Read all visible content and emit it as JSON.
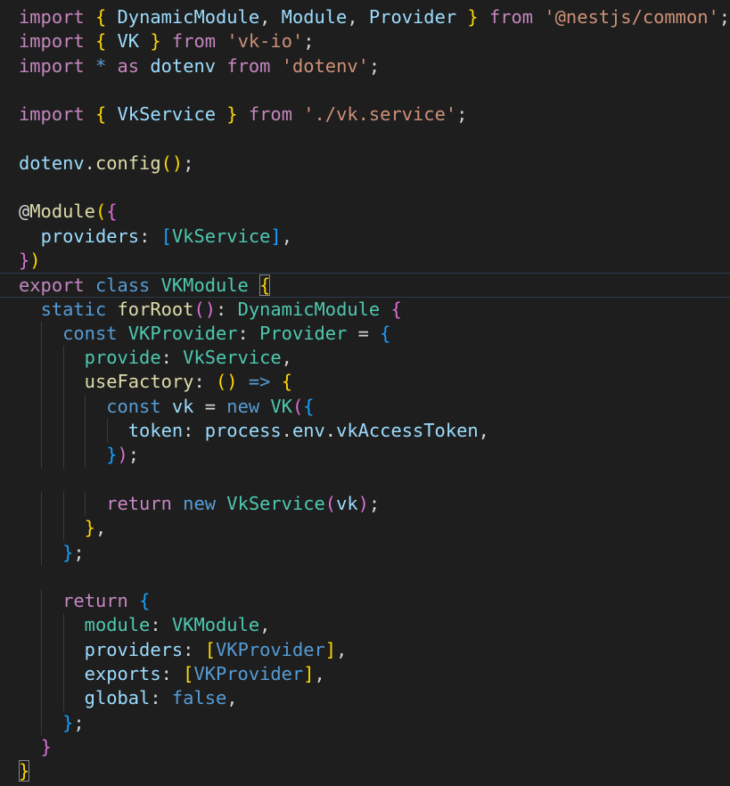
{
  "colors": {
    "background": "#1e1e1e",
    "keyword": "#c586c0",
    "storage": "#569cd6",
    "type": "#4ec9b0",
    "function": "#dcdcaa",
    "variable": "#9cdcfe",
    "string": "#ce9178",
    "plain": "#d4d4d4",
    "bracket_gold": "#ffd700",
    "bracket_pink": "#da70d6",
    "bracket_blue": "#179fff"
  },
  "lines": [
    [
      {
        "t": "import",
        "c": "keyword"
      },
      {
        "t": " "
      },
      {
        "t": "{",
        "c": "bracket_gold"
      },
      {
        "t": " "
      },
      {
        "t": "DynamicModule",
        "c": "variable"
      },
      {
        "t": ", "
      },
      {
        "t": "Module",
        "c": "variable"
      },
      {
        "t": ", "
      },
      {
        "t": "Provider",
        "c": "variable"
      },
      {
        "t": " "
      },
      {
        "t": "}",
        "c": "bracket_gold"
      },
      {
        "t": " "
      },
      {
        "t": "from",
        "c": "keyword"
      },
      {
        "t": " "
      },
      {
        "t": "'@nestjs/common'",
        "c": "string"
      },
      {
        "t": ";"
      }
    ],
    [
      {
        "t": "import",
        "c": "keyword"
      },
      {
        "t": " "
      },
      {
        "t": "{",
        "c": "bracket_gold"
      },
      {
        "t": " "
      },
      {
        "t": "VK",
        "c": "variable"
      },
      {
        "t": " "
      },
      {
        "t": "}",
        "c": "bracket_gold"
      },
      {
        "t": " "
      },
      {
        "t": "from",
        "c": "keyword"
      },
      {
        "t": " "
      },
      {
        "t": "'vk-io'",
        "c": "string"
      },
      {
        "t": ";"
      }
    ],
    [
      {
        "t": "import",
        "c": "keyword"
      },
      {
        "t": " "
      },
      {
        "t": "*",
        "c": "storage"
      },
      {
        "t": " "
      },
      {
        "t": "as",
        "c": "keyword"
      },
      {
        "t": " "
      },
      {
        "t": "dotenv",
        "c": "variable"
      },
      {
        "t": " "
      },
      {
        "t": "from",
        "c": "keyword"
      },
      {
        "t": " "
      },
      {
        "t": "'dotenv'",
        "c": "string"
      },
      {
        "t": ";"
      }
    ],
    [],
    [
      {
        "t": "import",
        "c": "keyword"
      },
      {
        "t": " "
      },
      {
        "t": "{",
        "c": "bracket_gold"
      },
      {
        "t": " "
      },
      {
        "t": "VkService",
        "c": "variable"
      },
      {
        "t": " "
      },
      {
        "t": "}",
        "c": "bracket_gold"
      },
      {
        "t": " "
      },
      {
        "t": "from",
        "c": "keyword"
      },
      {
        "t": " "
      },
      {
        "t": "'./vk.service'",
        "c": "string"
      },
      {
        "t": ";"
      }
    ],
    [],
    [
      {
        "t": "dotenv",
        "c": "variable"
      },
      {
        "t": "."
      },
      {
        "t": "config",
        "c": "function"
      },
      {
        "t": "(",
        "c": "bracket_gold"
      },
      {
        "t": ")",
        "c": "bracket_gold"
      },
      {
        "t": ";"
      }
    ],
    [],
    [
      {
        "t": "@"
      },
      {
        "t": "Module",
        "c": "function"
      },
      {
        "t": "(",
        "c": "bracket_gold"
      },
      {
        "t": "{",
        "c": "bracket_pink"
      }
    ],
    [
      {
        "t": "  "
      },
      {
        "t": "providers",
        "c": "variable"
      },
      {
        "t": ": "
      },
      {
        "t": "[",
        "c": "bracket_blue"
      },
      {
        "t": "VkService",
        "c": "type"
      },
      {
        "t": "]",
        "c": "bracket_blue"
      },
      {
        "t": ","
      }
    ],
    [
      {
        "t": "}",
        "c": "bracket_pink"
      },
      {
        "t": ")",
        "c": "bracket_gold"
      }
    ],
    [
      {
        "t": "export",
        "c": "keyword"
      },
      {
        "t": " "
      },
      {
        "t": "class",
        "c": "storage"
      },
      {
        "t": " "
      },
      {
        "t": "VKModule",
        "c": "type"
      },
      {
        "t": " "
      },
      {
        "t": "{",
        "c": "bracket_gold",
        "box": true
      }
    ],
    [
      {
        "t": "  "
      },
      {
        "t": "static",
        "c": "storage"
      },
      {
        "t": " "
      },
      {
        "t": "forRoot",
        "c": "function"
      },
      {
        "t": "(",
        "c": "bracket_pink"
      },
      {
        "t": ")",
        "c": "bracket_pink"
      },
      {
        "t": ": "
      },
      {
        "t": "DynamicModule",
        "c": "type"
      },
      {
        "t": " "
      },
      {
        "t": "{",
        "c": "bracket_pink"
      }
    ],
    [
      {
        "t": "    "
      },
      {
        "t": "const",
        "c": "storage"
      },
      {
        "t": " "
      },
      {
        "t": "VKProvider",
        "c": "type"
      },
      {
        "t": ": "
      },
      {
        "t": "Provider",
        "c": "type"
      },
      {
        "t": " = "
      },
      {
        "t": "{",
        "c": "bracket_blue"
      }
    ],
    [
      {
        "t": "      "
      },
      {
        "t": "provide",
        "c": "type"
      },
      {
        "t": ": "
      },
      {
        "t": "VkService",
        "c": "type"
      },
      {
        "t": ","
      }
    ],
    [
      {
        "t": "      "
      },
      {
        "t": "useFactory",
        "c": "function"
      },
      {
        "t": ": "
      },
      {
        "t": "(",
        "c": "bracket_gold"
      },
      {
        "t": ")",
        "c": "bracket_gold"
      },
      {
        "t": " "
      },
      {
        "t": "=>",
        "c": "storage"
      },
      {
        "t": " "
      },
      {
        "t": "{",
        "c": "bracket_gold"
      }
    ],
    [
      {
        "t": "        "
      },
      {
        "t": "const",
        "c": "storage"
      },
      {
        "t": " "
      },
      {
        "t": "vk",
        "c": "variable"
      },
      {
        "t": " = "
      },
      {
        "t": "new",
        "c": "storage"
      },
      {
        "t": " "
      },
      {
        "t": "VK",
        "c": "type"
      },
      {
        "t": "(",
        "c": "bracket_pink"
      },
      {
        "t": "{",
        "c": "bracket_blue"
      }
    ],
    [
      {
        "t": "          "
      },
      {
        "t": "token",
        "c": "variable"
      },
      {
        "t": ": "
      },
      {
        "t": "process",
        "c": "variable"
      },
      {
        "t": "."
      },
      {
        "t": "env",
        "c": "variable"
      },
      {
        "t": "."
      },
      {
        "t": "vkAccessToken",
        "c": "variable"
      },
      {
        "t": ","
      }
    ],
    [
      {
        "t": "        "
      },
      {
        "t": "}",
        "c": "bracket_blue"
      },
      {
        "t": ")",
        "c": "bracket_pink"
      },
      {
        "t": ";"
      }
    ],
    [],
    [
      {
        "t": "        "
      },
      {
        "t": "return",
        "c": "keyword"
      },
      {
        "t": " "
      },
      {
        "t": "new",
        "c": "storage"
      },
      {
        "t": " "
      },
      {
        "t": "VkService",
        "c": "type"
      },
      {
        "t": "(",
        "c": "bracket_pink"
      },
      {
        "t": "vk",
        "c": "variable"
      },
      {
        "t": ")",
        "c": "bracket_pink"
      },
      {
        "t": ";"
      }
    ],
    [
      {
        "t": "      "
      },
      {
        "t": "}",
        "c": "bracket_gold"
      },
      {
        "t": ","
      }
    ],
    [
      {
        "t": "    "
      },
      {
        "t": "}",
        "c": "bracket_blue"
      },
      {
        "t": ";"
      }
    ],
    [],
    [
      {
        "t": "    "
      },
      {
        "t": "return",
        "c": "keyword"
      },
      {
        "t": " "
      },
      {
        "t": "{",
        "c": "bracket_blue"
      }
    ],
    [
      {
        "t": "      "
      },
      {
        "t": "module",
        "c": "type"
      },
      {
        "t": ": "
      },
      {
        "t": "VKModule",
        "c": "type"
      },
      {
        "t": ","
      }
    ],
    [
      {
        "t": "      "
      },
      {
        "t": "providers",
        "c": "variable"
      },
      {
        "t": ": "
      },
      {
        "t": "[",
        "c": "bracket_gold"
      },
      {
        "t": "VKProvider",
        "c": "storage"
      },
      {
        "t": "]",
        "c": "bracket_gold"
      },
      {
        "t": ","
      }
    ],
    [
      {
        "t": "      "
      },
      {
        "t": "exports",
        "c": "variable"
      },
      {
        "t": ": "
      },
      {
        "t": "[",
        "c": "bracket_gold"
      },
      {
        "t": "VKProvider",
        "c": "storage"
      },
      {
        "t": "]",
        "c": "bracket_gold"
      },
      {
        "t": ","
      }
    ],
    [
      {
        "t": "      "
      },
      {
        "t": "global",
        "c": "variable"
      },
      {
        "t": ": "
      },
      {
        "t": "false",
        "c": "storage"
      },
      {
        "t": ","
      }
    ],
    [
      {
        "t": "    "
      },
      {
        "t": "}",
        "c": "bracket_blue"
      },
      {
        "t": ";"
      }
    ],
    [
      {
        "t": "  "
      },
      {
        "t": "}",
        "c": "bracket_pink"
      }
    ],
    [
      {
        "t": "}",
        "c": "bracket_gold",
        "box": true
      }
    ]
  ],
  "current_line_index": 11
}
